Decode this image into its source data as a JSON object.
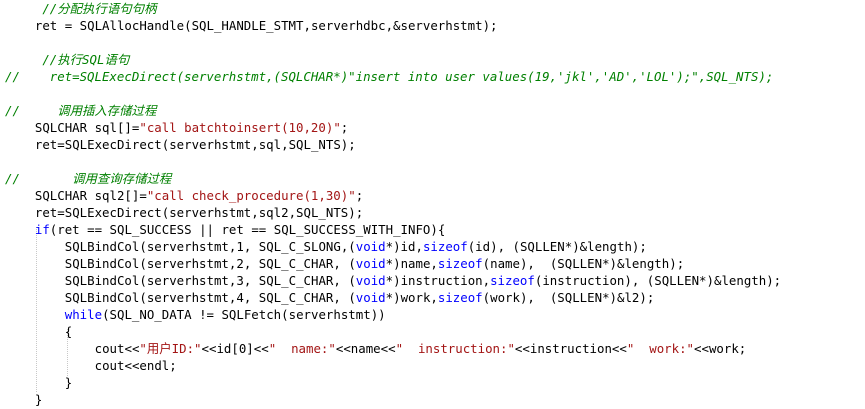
{
  "editor": {
    "lines": [
      "     //分配执行语句句柄",
      "    ret = SQLAllocHandle(SQL_HANDLE_STMT,serverhdbc,&serverhstmt);",
      "",
      "     //执行SQL语句",
      "//    ret=SQLExecDirect(serverhstmt,(SQLCHAR*)\"insert into user values(19,'jkl','AD','LOL');\",SQL_NTS);",
      "",
      "//     调用插入存储过程",
      "    SQLCHAR sql[]=\"call batchtoinsert(10,20)\";",
      "    ret=SQLExecDirect(serverhstmt,sql,SQL_NTS);",
      "",
      "//       调用查询存储过程",
      "    SQLCHAR sql2[]=\"call check_procedure(1,30)\";",
      "    ret=SQLExecDirect(serverhstmt,sql2,SQL_NTS);",
      "    if(ret == SQL_SUCCESS || ret == SQL_SUCCESS_WITH_INFO){",
      "        SQLBindCol(serverhstmt,1, SQL_C_SLONG,(void*)id,sizeof(id), (SQLLEN*)&length);",
      "        SQLBindCol(serverhstmt,2, SQL_C_CHAR, (void*)name,sizeof(name),  (SQLLEN*)&length);",
      "        SQLBindCol(serverhstmt,3, SQL_C_CHAR, (void*)instruction,sizeof(instruction), (SQLLEN*)&length);",
      "        SQLBindCol(serverhstmt,4, SQL_C_CHAR, (void*)work,sizeof(work),  (SQLLEN*)&l2);",
      "        while(SQL_NO_DATA != SQLFetch(serverhstmt))",
      "        {",
      "            cout<<\"用户ID:\"<<id[0]<<\"  name:\"<<name<<\"  instruction:\"<<instruction<<\"  work:\"<<work;",
      "            cout<<endl;",
      "        }",
      "    }"
    ]
  }
}
